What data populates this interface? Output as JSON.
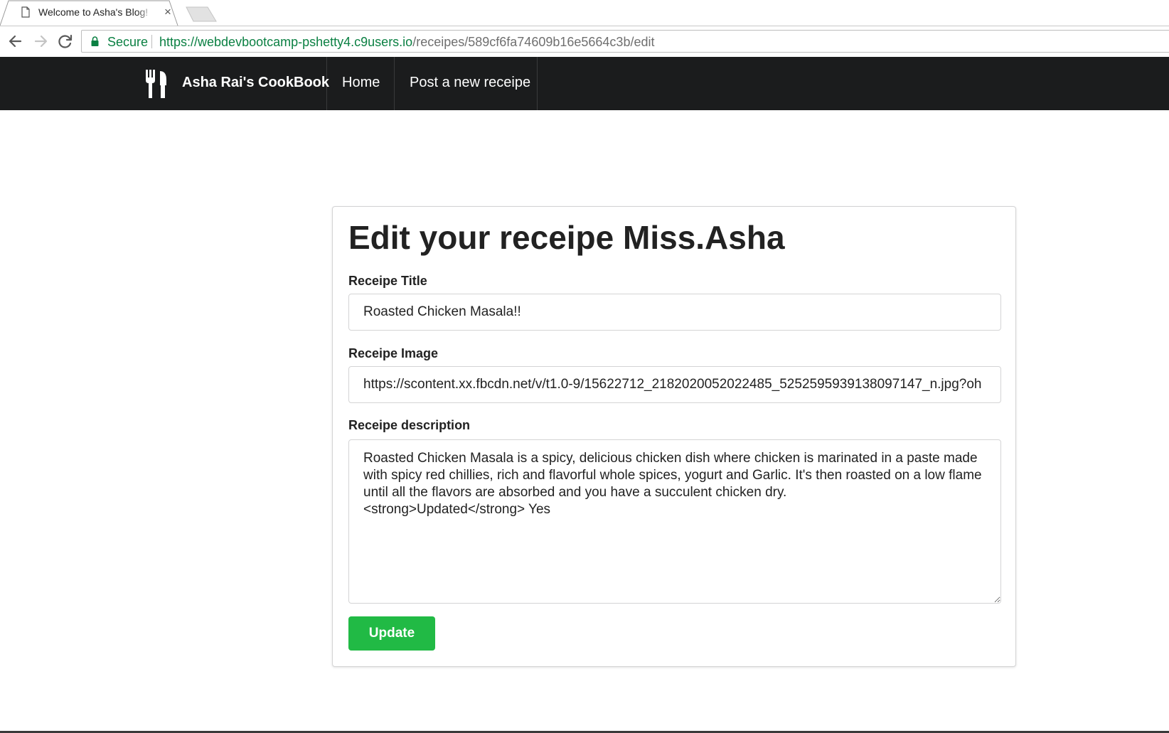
{
  "browser": {
    "tab_title": "Welcome to Asha's Blog!",
    "tab_close": "×",
    "secure_label": "Secure",
    "url_scheme_host": "https://webdevbootcamp-pshetty4.c9users.io",
    "url_path": "/receipes/589cf6fa74609b16e5664c3b/edit",
    "icons": [
      "page-icon",
      "back-arrow-icon",
      "forward-arrow-icon",
      "reload-icon",
      "lock-icon"
    ]
  },
  "navbar": {
    "brand": "Asha Rai's CookBook",
    "brand_icon": "fork-knife-icon",
    "items": [
      {
        "label": "Home"
      },
      {
        "label": "Post a new receipe"
      }
    ],
    "background": "#1b1c1d"
  },
  "form": {
    "heading": "Edit your receipe Miss.Asha",
    "title_label": "Receipe Title",
    "title_value": "Roasted Chicken Masala!!",
    "image_label": "Receipe Image",
    "image_value": "https://scontent.xx.fbcdn.net/v/t1.0-9/15622712_2182020052022485_5252595939138097147_n.jpg?oh",
    "description_label": "Receipe description",
    "description_value": "Roasted Chicken Masala is a spicy, delicious chicken dish where chicken is marinated in a paste made with spicy red chillies, rich and flavorful whole spices, yogurt and Garlic. It's then roasted on a low flame until all the flavors are absorbed and you have a succulent chicken dry.\n<strong>Updated</strong> Yes",
    "submit_label": "Update",
    "submit_color": "#21ba45"
  }
}
